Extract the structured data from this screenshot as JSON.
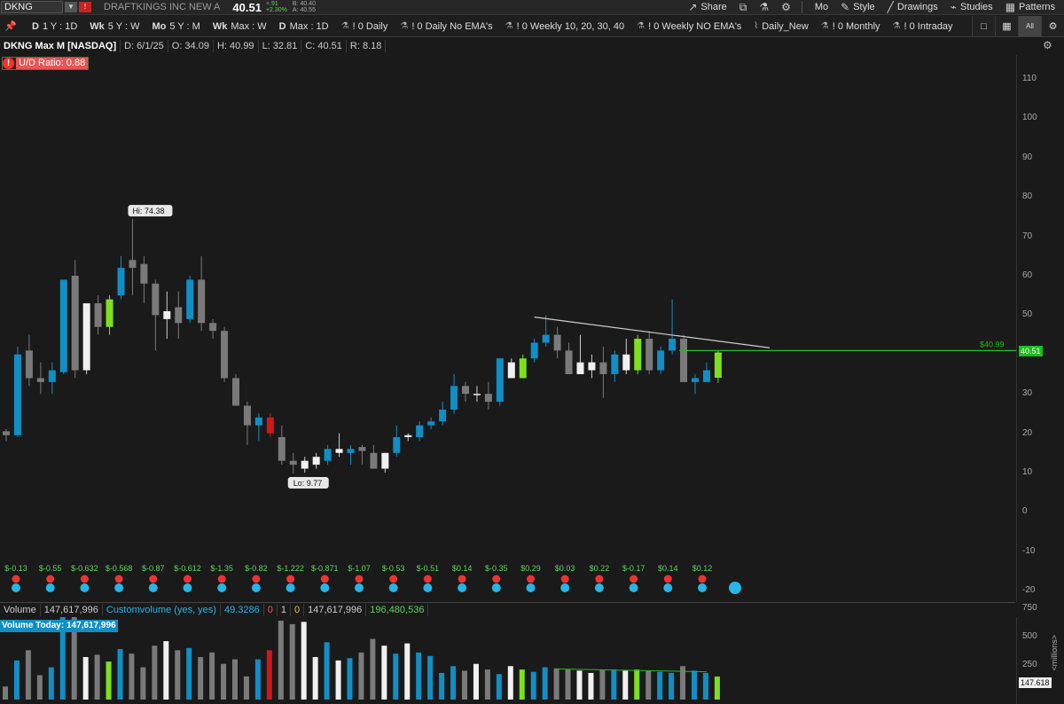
{
  "toolbar": {
    "symbol": "DKNG",
    "company": "DRAFTKINGS INC NEW A",
    "last": "40.51",
    "change": "+.91",
    "change_pct": "+2.30%",
    "bid": "B: 40.40",
    "ask": "A: 40.55",
    "share": "Share",
    "timeframe": "Mo",
    "style": "Style",
    "drawings": "Drawings",
    "studies": "Studies",
    "patterns": "Patterns"
  },
  "flexgrid": {
    "items": [
      {
        "prefix": "D",
        "label": "1 Y : 1D"
      },
      {
        "prefix": "Wk",
        "label": "5 Y : W"
      },
      {
        "prefix": "Mo",
        "label": "5 Y : M"
      },
      {
        "prefix": "Wk",
        "label": "Max : W"
      },
      {
        "prefix": "D",
        "label": "Max : 1D"
      }
    ],
    "styles": [
      "! 0 Daily",
      "! 0 Daily No EMA's",
      "! 0 Weekly 10, 20, 30, 40",
      "! 0 Weekly NO EMA's",
      "Daily_New",
      "! 0 Monthly",
      "! 0 Intraday"
    ],
    "all": "All"
  },
  "info": {
    "title": "DKNG Max M [NASDAQ]",
    "date": "D: 6/1/25",
    "open": "O: 34.09",
    "high": "H: 40.99",
    "low": "L: 32.81",
    "close": "C: 40.51",
    "range": "R: 8.18"
  },
  "ud_ratio": "U/D Ratio: 0.88",
  "chart_data": {
    "type": "candlestick",
    "ylim": [
      -20,
      115
    ],
    "yticks": [
      110,
      100,
      90,
      80,
      70,
      60,
      50,
      40,
      30,
      20,
      10,
      0,
      -10,
      -20
    ],
    "candles": [
      {
        "o": 19.5,
        "h": 21,
        "l": 18,
        "c": 20.5,
        "k": "grey"
      },
      {
        "o": 19.5,
        "h": 42,
        "l": 19,
        "c": 40,
        "k": "blue"
      },
      {
        "o": 34,
        "h": 45,
        "l": 32,
        "c": 41,
        "k": "grey"
      },
      {
        "o": 34,
        "h": 38,
        "l": 30,
        "c": 33,
        "k": "grey"
      },
      {
        "o": 33,
        "h": 38,
        "l": 30,
        "c": 36,
        "k": "blue"
      },
      {
        "o": 35.5,
        "h": 59,
        "l": 35,
        "c": 59,
        "k": "blue"
      },
      {
        "o": 60,
        "h": 64,
        "l": 34,
        "c": 36,
        "k": "grey"
      },
      {
        "o": 36,
        "h": 53,
        "l": 35,
        "c": 53,
        "k": "white"
      },
      {
        "o": 53,
        "h": 55,
        "l": 45,
        "c": 47,
        "k": "grey"
      },
      {
        "o": 47,
        "h": 55,
        "l": 45,
        "c": 54,
        "k": "green"
      },
      {
        "o": 55,
        "h": 65,
        "l": 54,
        "c": 62,
        "k": "blue"
      },
      {
        "o": 62,
        "h": 74.38,
        "l": 55,
        "c": 64,
        "k": "grey"
      },
      {
        "o": 63,
        "h": 65,
        "l": 53,
        "c": 58,
        "k": "grey"
      },
      {
        "o": 58,
        "h": 59,
        "l": 41,
        "c": 50,
        "k": "grey"
      },
      {
        "o": 51,
        "h": 56,
        "l": 44,
        "c": 49,
        "k": "white"
      },
      {
        "o": 52,
        "h": 56,
        "l": 44,
        "c": 48,
        "k": "grey"
      },
      {
        "o": 49,
        "h": 60,
        "l": 48,
        "c": 59,
        "k": "blue"
      },
      {
        "o": 59,
        "h": 65,
        "l": 46,
        "c": 48,
        "k": "grey"
      },
      {
        "o": 48,
        "h": 49,
        "l": 44,
        "c": 46,
        "k": "grey"
      },
      {
        "o": 46,
        "h": 47,
        "l": 33,
        "c": 34,
        "k": "grey"
      },
      {
        "o": 34,
        "h": 35,
        "l": 27,
        "c": 27,
        "k": "grey"
      },
      {
        "o": 27,
        "h": 28,
        "l": 17,
        "c": 22,
        "k": "grey"
      },
      {
        "o": 22,
        "h": 25,
        "l": 18,
        "c": 24,
        "k": "blue"
      },
      {
        "o": 24,
        "h": 25,
        "l": 19,
        "c": 20,
        "k": "red"
      },
      {
        "o": 19,
        "h": 22,
        "l": 12,
        "c": 13,
        "k": "grey"
      },
      {
        "o": 13,
        "h": 15,
        "l": 9.77,
        "c": 12,
        "k": "grey"
      },
      {
        "o": 11,
        "h": 14,
        "l": 10,
        "c": 13,
        "k": "white"
      },
      {
        "o": 12,
        "h": 15,
        "l": 11,
        "c": 14,
        "k": "white"
      },
      {
        "o": 13,
        "h": 17,
        "l": 12,
        "c": 16,
        "k": "blue"
      },
      {
        "o": 15,
        "h": 20,
        "l": 14,
        "c": 16,
        "k": "white"
      },
      {
        "o": 15,
        "h": 17,
        "l": 12,
        "c": 16,
        "k": "blue"
      },
      {
        "o": 16.5,
        "h": 17,
        "l": 12,
        "c": 15.5,
        "k": "grey"
      },
      {
        "o": 15,
        "h": 17,
        "l": 11,
        "c": 11,
        "k": "grey"
      },
      {
        "o": 11,
        "h": 15,
        "l": 10,
        "c": 15,
        "k": "white"
      },
      {
        "o": 15,
        "h": 22,
        "l": 14,
        "c": 19,
        "k": "blue"
      },
      {
        "o": 19,
        "h": 20,
        "l": 18,
        "c": 19.5,
        "k": "white"
      },
      {
        "o": 19,
        "h": 23,
        "l": 18,
        "c": 22,
        "k": "blue"
      },
      {
        "o": 22,
        "h": 24,
        "l": 21,
        "c": 23,
        "k": "blue"
      },
      {
        "o": 23,
        "h": 28,
        "l": 22,
        "c": 26,
        "k": "blue"
      },
      {
        "o": 26,
        "h": 35,
        "l": 25,
        "c": 32,
        "k": "blue"
      },
      {
        "o": 32,
        "h": 33,
        "l": 28,
        "c": 30,
        "k": "grey"
      },
      {
        "o": 30,
        "h": 32,
        "l": 28,
        "c": 30,
        "k": "white"
      },
      {
        "o": 30,
        "h": 33,
        "l": 26,
        "c": 28,
        "k": "grey"
      },
      {
        "o": 28,
        "h": 39,
        "l": 27,
        "c": 39,
        "k": "blue"
      },
      {
        "o": 34,
        "h": 39,
        "l": 34,
        "c": 38,
        "k": "white"
      },
      {
        "o": 34,
        "h": 40,
        "l": 34,
        "c": 39,
        "k": "green"
      },
      {
        "o": 39,
        "h": 44,
        "l": 38,
        "c": 43,
        "k": "blue"
      },
      {
        "o": 43,
        "h": 50,
        "l": 42,
        "c": 45,
        "k": "blue"
      },
      {
        "o": 45,
        "h": 47,
        "l": 39,
        "c": 41,
        "k": "grey"
      },
      {
        "o": 41,
        "h": 43,
        "l": 35,
        "c": 35,
        "k": "grey"
      },
      {
        "o": 35,
        "h": 45,
        "l": 35,
        "c": 38,
        "k": "white"
      },
      {
        "o": 36,
        "h": 40,
        "l": 34,
        "c": 38,
        "k": "white"
      },
      {
        "o": 38,
        "h": 42,
        "l": 29,
        "c": 35,
        "k": "grey"
      },
      {
        "o": 35,
        "h": 41,
        "l": 33,
        "c": 40,
        "k": "blue"
      },
      {
        "o": 40,
        "h": 44,
        "l": 35,
        "c": 36,
        "k": "white"
      },
      {
        "o": 36,
        "h": 45,
        "l": 35,
        "c": 44,
        "k": "green"
      },
      {
        "o": 44,
        "h": 46,
        "l": 35,
        "c": 36,
        "k": "grey"
      },
      {
        "o": 36,
        "h": 42,
        "l": 35,
        "c": 41,
        "k": "blue"
      },
      {
        "o": 41,
        "h": 54,
        "l": 40,
        "c": 44,
        "k": "blue"
      },
      {
        "o": 44,
        "h": 45,
        "l": 33,
        "c": 33,
        "k": "grey"
      },
      {
        "o": 33,
        "h": 35,
        "l": 30,
        "c": 34,
        "k": "blue"
      },
      {
        "o": 33,
        "h": 38,
        "l": 33,
        "c": 36,
        "k": "blue"
      },
      {
        "o": 34.09,
        "h": 40.99,
        "l": 32.81,
        "c": 40.51,
        "k": "green"
      }
    ],
    "hi_label": "Hi: 74.38",
    "lo_label": "Lo: 9.77",
    "hline_label": "$40.99",
    "price_tag": "40.51",
    "earnings": [
      "$-0.13",
      "$-0.55",
      "$-0.632",
      "$-0.568",
      "$-0.87",
      "$-0.612",
      "$-1.35",
      "$-0.82",
      "$-1.222",
      "$-0.871",
      "$-1.07",
      "$-0.53",
      "$-0.51",
      "$0.14",
      "$-0.35",
      "$0.29",
      "$0.03",
      "$0.22",
      "$-0.17",
      "$0.14",
      "$0.12"
    ],
    "volume": {
      "ylim": [
        0,
        900
      ],
      "yticks": [
        750,
        500,
        250
      ],
      "values": [
        60,
        290,
        380,
        160,
        230,
        690,
        830,
        320,
        340,
        280,
        390,
        350,
        230,
        420,
        460,
        380,
        400,
        320,
        360,
        260,
        300,
        150,
        300,
        380,
        640,
        610,
        630,
        320,
        450,
        290,
        310,
        360,
        480,
        420,
        350,
        440,
        360,
        330,
        180,
        240,
        200,
        260,
        210,
        170,
        240,
        210,
        190,
        230,
        220,
        210,
        200,
        180,
        210,
        210,
        200,
        210,
        200,
        190,
        180,
        240,
        200,
        180,
        147.618
      ],
      "today_label": "147.618",
      "unit": "<millions>"
    }
  },
  "volume_info": {
    "label": "Volume",
    "value": "147,617,996",
    "custom": "Customvolume (yes, yes)",
    "v1": "49.3286",
    "v2": "0",
    "v3": "1",
    "v4": "0",
    "v5": "147,617,996",
    "v6": "196,480,536",
    "today": "Volume Today: 147,617,996"
  },
  "colors": {
    "blue": "#0f8fc6",
    "grey": "#7a7a7a",
    "white": "#f0f0f0",
    "green": "#7de01f",
    "red": "#d01818",
    "hline": "#19c019"
  }
}
